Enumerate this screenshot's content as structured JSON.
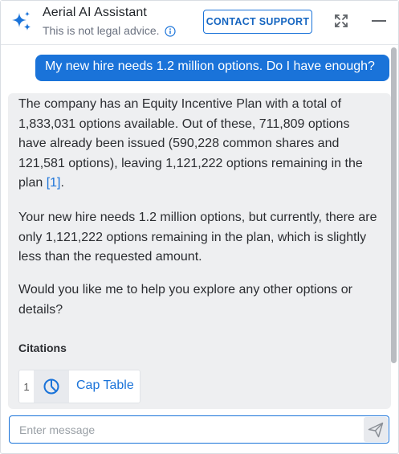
{
  "header": {
    "title": "Aerial AI Assistant",
    "subtitle": "This is not legal advice.",
    "contact_label": "CONTACT SUPPORT",
    "icons": [
      "sparkle-icon",
      "info-icon",
      "expand-icon",
      "minimize-icon"
    ]
  },
  "chat": {
    "user_message": "My new hire needs 1.2 million options. Do I have enough?",
    "assistant": {
      "p1": "The company has an Equity Incentive Plan with a total of 1,833,031 options available. Out of these, 711,809 options have already been issued (590,228 common shares and 121,581 options), leaving 1,121,222 options remaining in the plan",
      "p1_citation": "[1]",
      "p1_end": ".",
      "p2": "Your new hire needs 1.2 million options, but currently, there are only 1,121,222 options remaining in the plan, which is slightly less than the requested amount.",
      "p3": "Would you like me to help you explore any other options or details?",
      "citations_label": "Citations",
      "citations": [
        {
          "number": "1",
          "title": "Cap Table",
          "icon": "pie-chart-icon"
        }
      ]
    }
  },
  "input": {
    "placeholder": "Enter message",
    "value": "",
    "send_icon": "send-icon"
  },
  "colors": {
    "accent": "#1a73d9",
    "assistant_bg": "#eeeff1",
    "text": "#2b2d31"
  }
}
